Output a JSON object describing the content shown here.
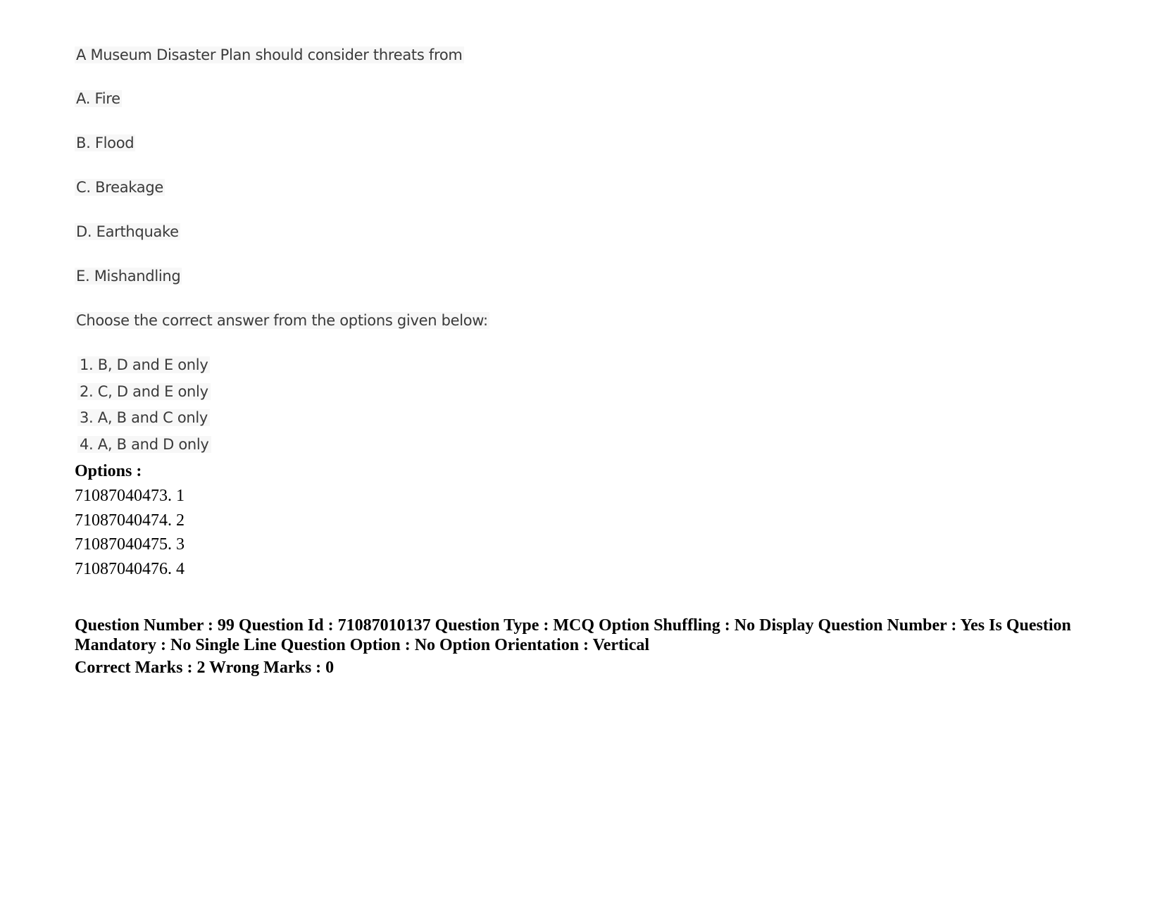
{
  "question": {
    "stem": "A Museum Disaster Plan should consider threats from",
    "statements": [
      "A. Fire",
      "B. Flood",
      "C. Breakage",
      "D. Earthquake",
      "E. Mishandling"
    ],
    "instruction": "Choose the correct answer from the options given below:",
    "choices": [
      "1. B, D and E only",
      "2. C, D and E only",
      "3. A, B and C only",
      "4. A, B and D only"
    ]
  },
  "options": {
    "heading": "Options :",
    "items": [
      "71087040473. 1",
      "71087040474. 2",
      "71087040475. 3",
      "71087040476. 4"
    ]
  },
  "next_question": {
    "meta_text": "Question Number : 99 Question Id : 71087010137 Question Type : MCQ Option Shuffling : No Display Question Number : Yes Is Question Mandatory : No Single Line Question Option : No Option Orientation : Vertical",
    "marks_text": "Correct Marks : 2 Wrong Marks : 0"
  }
}
